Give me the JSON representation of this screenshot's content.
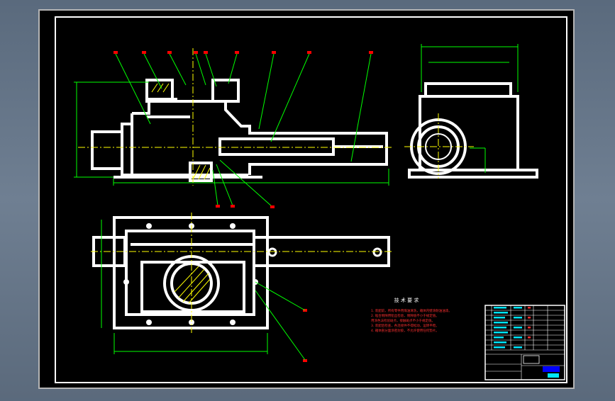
{
  "drawing": {
    "notes_heading": "技 术 要 求",
    "notes": [
      "1. 装配前，所有零件用煤油清洗，箱体内壁涂耐油油漆。",
      "2. 啮合侧隙用铅丝检验，侧隙值不小于规定值。",
      "   用涂色法检验斑点，接触斑点不小于规定值。",
      "3. 装配后检查，各连接件不得松动，运转平稳。",
      "4. 箱体剖分面涂密封胶，不允许使用任何垫片。"
    ],
    "colors": {
      "background": "#000000",
      "geometry": "#ffffff",
      "dimension": "#00ff00",
      "centerline": "#ffff00",
      "balloon": "#ff0000",
      "text_red": "#ff3030",
      "title_accent": "#0000ff",
      "table_text": "#00e5ff"
    }
  }
}
